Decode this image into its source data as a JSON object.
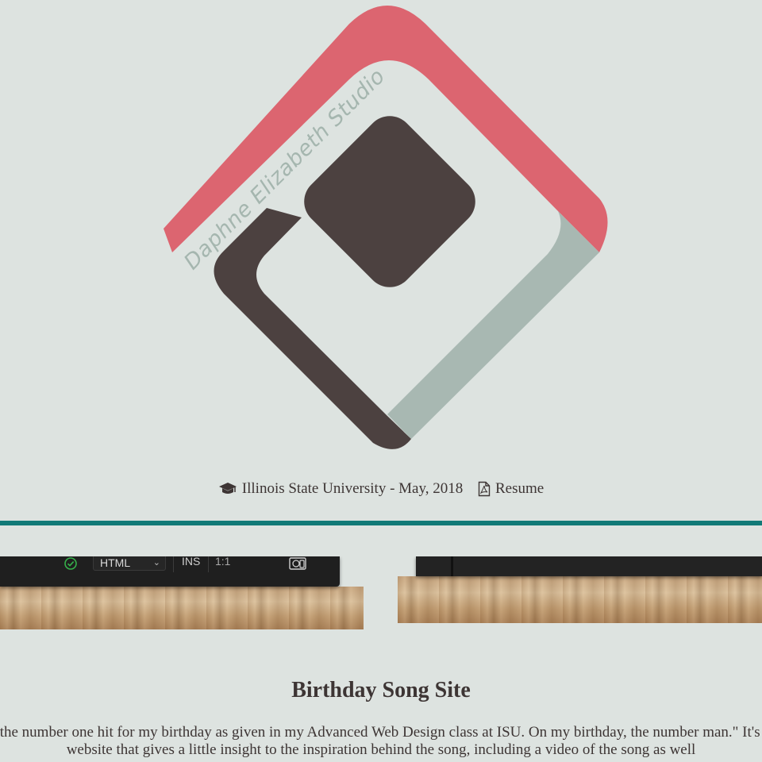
{
  "brand": {
    "logo_text": "Daphne Elizabeth Studio",
    "colors": {
      "coral": "#dc6570",
      "sage": "#a8b8b2",
      "dark_brown": "#4c4140",
      "background": "#dde3e0",
      "divider_teal": "#117a77"
    }
  },
  "info": {
    "education_icon": "graduation-cap-icon",
    "education_text": "Illinois State University - May, 2018",
    "resume_icon": "pdf-file-icon",
    "resume_text": "Resume"
  },
  "thumbnails": [
    {
      "name": "editor-screenshot-left",
      "status_icon": "check-circle-icon",
      "language": "HTML",
      "mode": "INS",
      "cursor_position": "1:1",
      "preview_icon": "live-preview-icon"
    },
    {
      "name": "editor-screenshot-right"
    }
  ],
  "project": {
    "title": "Birthday Song Site",
    "description": "ed around the number one hit for my birthday as given in my Advanced Web Design class at ISU. On my birthday, the number man.\" It's a fun little website that gives a little insight to the inspiration behind the song, including a video of the song as well"
  }
}
